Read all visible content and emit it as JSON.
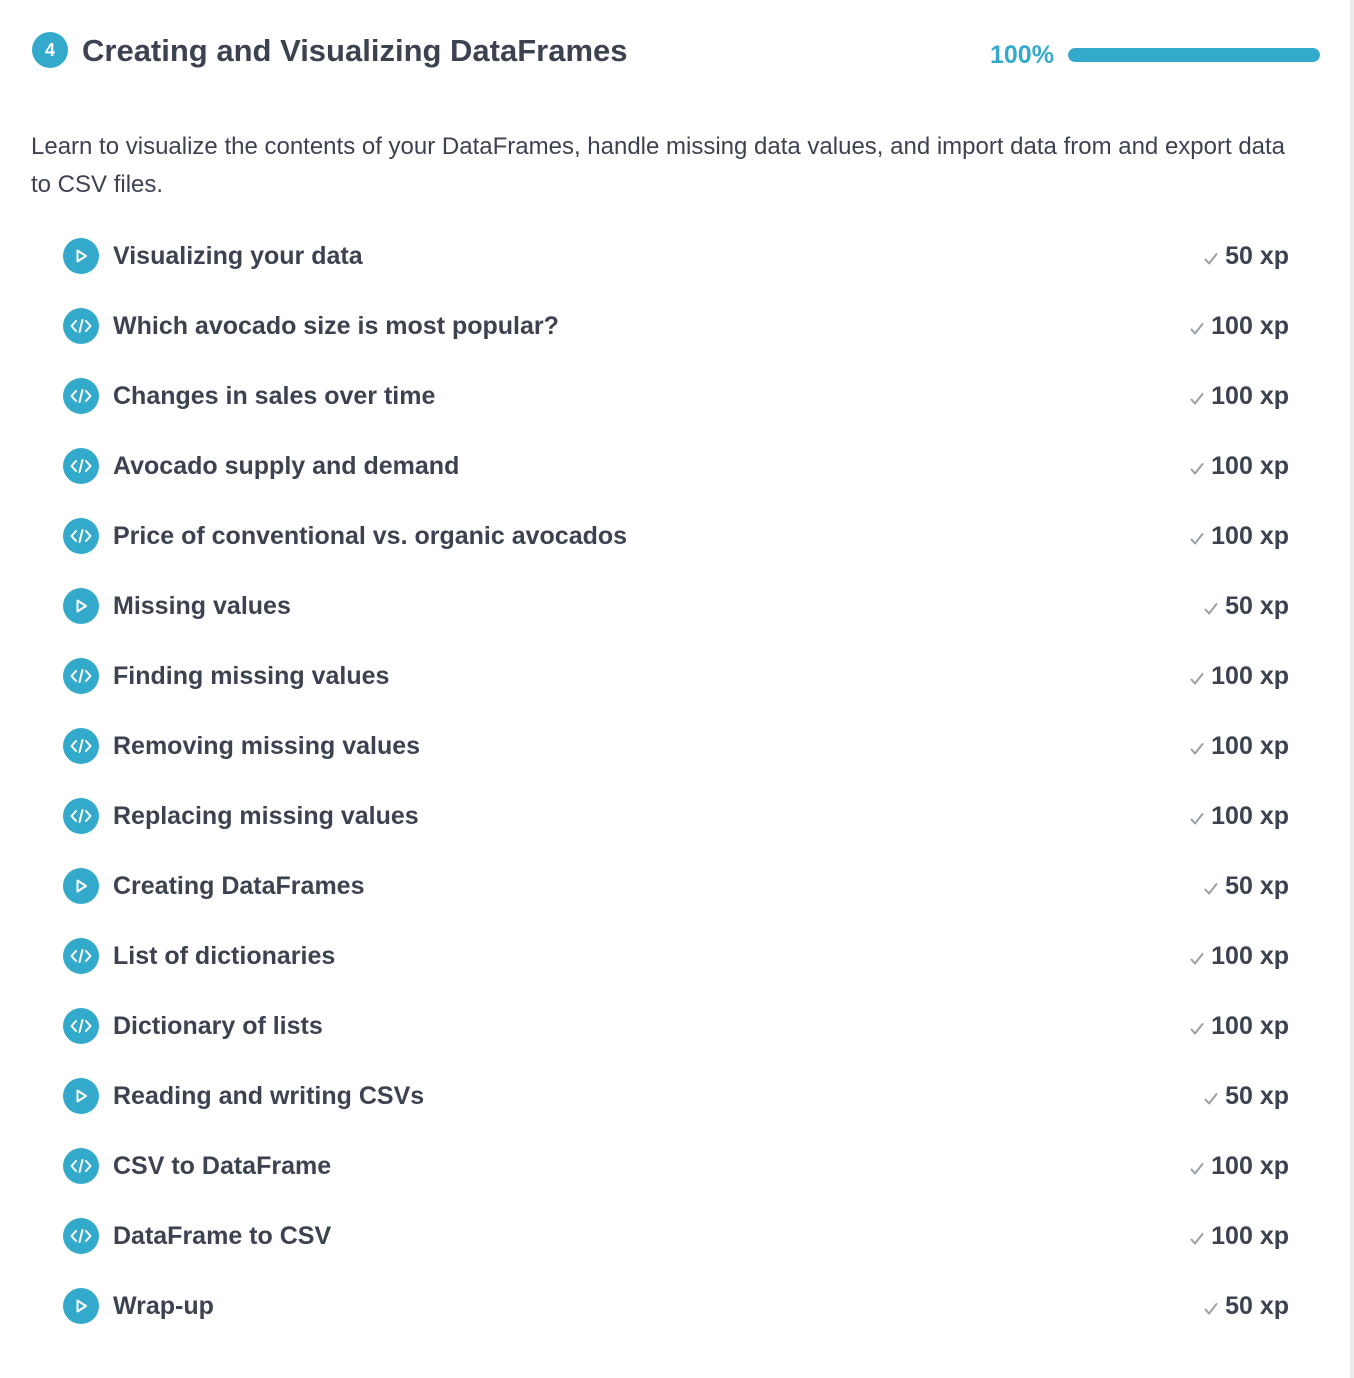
{
  "chapter": {
    "number": "4",
    "title": "Creating and Visualizing DataFrames",
    "progress_text": "100%",
    "progress_fraction": 1.0,
    "description": "Learn to visualize the contents of your DataFrames, handle missing data values, and import data from and export data to CSV files."
  },
  "colors": {
    "accent": "#33aacc",
    "text": "#3d4251",
    "check": "#9aa0a6"
  },
  "exercises": [
    {
      "title": "Visualizing your data",
      "type": "video",
      "icon": "play-icon",
      "xp": "50 xp"
    },
    {
      "title": "Which avocado size is most popular?",
      "type": "code",
      "icon": "code-icon",
      "xp": "100 xp"
    },
    {
      "title": "Changes in sales over time",
      "type": "code",
      "icon": "code-icon",
      "xp": "100 xp"
    },
    {
      "title": "Avocado supply and demand",
      "type": "code",
      "icon": "code-icon",
      "xp": "100 xp"
    },
    {
      "title": "Price of conventional vs. organic avocados",
      "type": "code",
      "icon": "code-icon",
      "xp": "100 xp"
    },
    {
      "title": "Missing values",
      "type": "video",
      "icon": "play-icon",
      "xp": "50 xp"
    },
    {
      "title": "Finding missing values",
      "type": "code",
      "icon": "code-icon",
      "xp": "100 xp"
    },
    {
      "title": "Removing missing values",
      "type": "code",
      "icon": "code-icon",
      "xp": "100 xp"
    },
    {
      "title": "Replacing missing values",
      "type": "code",
      "icon": "code-icon",
      "xp": "100 xp"
    },
    {
      "title": "Creating DataFrames",
      "type": "video",
      "icon": "play-icon",
      "xp": "50 xp"
    },
    {
      "title": "List of dictionaries",
      "type": "code",
      "icon": "code-icon",
      "xp": "100 xp"
    },
    {
      "title": "Dictionary of lists",
      "type": "code",
      "icon": "code-icon",
      "xp": "100 xp"
    },
    {
      "title": "Reading and writing CSVs",
      "type": "video",
      "icon": "play-icon",
      "xp": "50 xp"
    },
    {
      "title": "CSV to DataFrame",
      "type": "code",
      "icon": "code-icon",
      "xp": "100 xp"
    },
    {
      "title": "DataFrame to CSV",
      "type": "code",
      "icon": "code-icon",
      "xp": "100 xp"
    },
    {
      "title": "Wrap-up",
      "type": "video",
      "icon": "play-icon",
      "xp": "50 xp"
    }
  ]
}
